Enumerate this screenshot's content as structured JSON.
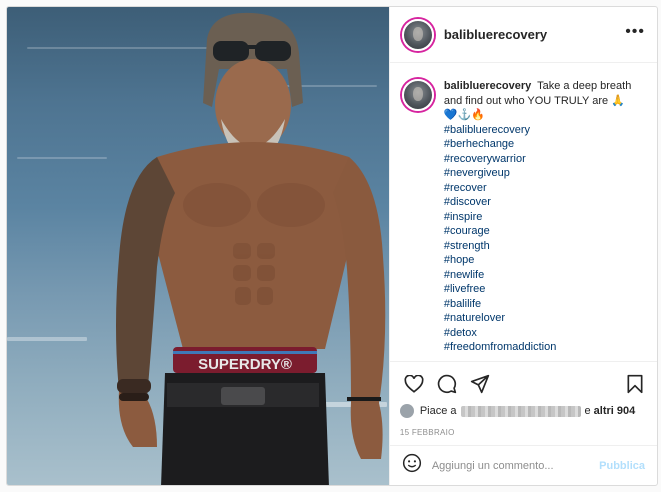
{
  "post": {
    "username": "balibluerecovery",
    "more_label": "•••",
    "caption": {
      "username": "balibluerecovery",
      "text": "Take a deep breath and find out who YOU TRULY are 🙏",
      "emojis": "💙⚓🔥",
      "hashtags": [
        "#balibluerecovery",
        "#berhechange",
        "#recoverywarrior",
        "#nevergiveup",
        "#recover",
        "#discover",
        "#inspire",
        "#courage",
        "#strength",
        "#hope",
        "#newlife",
        "#livefree",
        "#balilife",
        "#naturelover",
        "#detox",
        "#freedomfromaddiction"
      ]
    },
    "likes": {
      "prefix": "Piace a",
      "connector": "e",
      "others": "altri 904"
    },
    "date": "15 FEBBRAIO",
    "comment": {
      "placeholder": "Aggiungi un commento...",
      "publish_label": "Pubblica"
    },
    "photo": {
      "waistband_text": "SUPERDRY®"
    },
    "icons": {
      "like": "heart-icon",
      "comment": "comment-icon",
      "share": "share-icon",
      "save": "bookmark-icon",
      "emoji": "emoji-icon",
      "options": "more-options-icon"
    },
    "colors": {
      "link": "#00376b",
      "publish_disabled": "#b2dffc",
      "border": "#dbdbdb",
      "story_ring": "#d6249f"
    }
  }
}
